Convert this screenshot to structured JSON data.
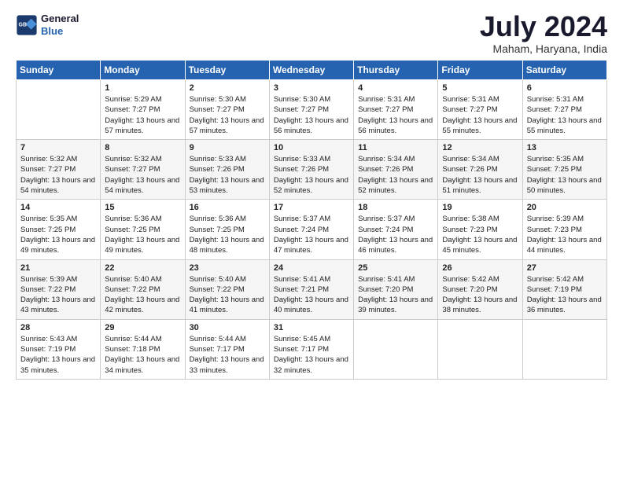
{
  "logo": {
    "line1": "General",
    "line2": "Blue"
  },
  "title": "July 2024",
  "location": "Maham, Haryana, India",
  "headers": [
    "Sunday",
    "Monday",
    "Tuesday",
    "Wednesday",
    "Thursday",
    "Friday",
    "Saturday"
  ],
  "weeks": [
    [
      {
        "day": "",
        "sunrise": "",
        "sunset": "",
        "daylight": ""
      },
      {
        "day": "1",
        "sunrise": "Sunrise: 5:29 AM",
        "sunset": "Sunset: 7:27 PM",
        "daylight": "Daylight: 13 hours and 57 minutes."
      },
      {
        "day": "2",
        "sunrise": "Sunrise: 5:30 AM",
        "sunset": "Sunset: 7:27 PM",
        "daylight": "Daylight: 13 hours and 57 minutes."
      },
      {
        "day": "3",
        "sunrise": "Sunrise: 5:30 AM",
        "sunset": "Sunset: 7:27 PM",
        "daylight": "Daylight: 13 hours and 56 minutes."
      },
      {
        "day": "4",
        "sunrise": "Sunrise: 5:31 AM",
        "sunset": "Sunset: 7:27 PM",
        "daylight": "Daylight: 13 hours and 56 minutes."
      },
      {
        "day": "5",
        "sunrise": "Sunrise: 5:31 AM",
        "sunset": "Sunset: 7:27 PM",
        "daylight": "Daylight: 13 hours and 55 minutes."
      },
      {
        "day": "6",
        "sunrise": "Sunrise: 5:31 AM",
        "sunset": "Sunset: 7:27 PM",
        "daylight": "Daylight: 13 hours and 55 minutes."
      }
    ],
    [
      {
        "day": "7",
        "sunrise": "Sunrise: 5:32 AM",
        "sunset": "Sunset: 7:27 PM",
        "daylight": "Daylight: 13 hours and 54 minutes."
      },
      {
        "day": "8",
        "sunrise": "Sunrise: 5:32 AM",
        "sunset": "Sunset: 7:27 PM",
        "daylight": "Daylight: 13 hours and 54 minutes."
      },
      {
        "day": "9",
        "sunrise": "Sunrise: 5:33 AM",
        "sunset": "Sunset: 7:26 PM",
        "daylight": "Daylight: 13 hours and 53 minutes."
      },
      {
        "day": "10",
        "sunrise": "Sunrise: 5:33 AM",
        "sunset": "Sunset: 7:26 PM",
        "daylight": "Daylight: 13 hours and 52 minutes."
      },
      {
        "day": "11",
        "sunrise": "Sunrise: 5:34 AM",
        "sunset": "Sunset: 7:26 PM",
        "daylight": "Daylight: 13 hours and 52 minutes."
      },
      {
        "day": "12",
        "sunrise": "Sunrise: 5:34 AM",
        "sunset": "Sunset: 7:26 PM",
        "daylight": "Daylight: 13 hours and 51 minutes."
      },
      {
        "day": "13",
        "sunrise": "Sunrise: 5:35 AM",
        "sunset": "Sunset: 7:25 PM",
        "daylight": "Daylight: 13 hours and 50 minutes."
      }
    ],
    [
      {
        "day": "14",
        "sunrise": "Sunrise: 5:35 AM",
        "sunset": "Sunset: 7:25 PM",
        "daylight": "Daylight: 13 hours and 49 minutes."
      },
      {
        "day": "15",
        "sunrise": "Sunrise: 5:36 AM",
        "sunset": "Sunset: 7:25 PM",
        "daylight": "Daylight: 13 hours and 49 minutes."
      },
      {
        "day": "16",
        "sunrise": "Sunrise: 5:36 AM",
        "sunset": "Sunset: 7:25 PM",
        "daylight": "Daylight: 13 hours and 48 minutes."
      },
      {
        "day": "17",
        "sunrise": "Sunrise: 5:37 AM",
        "sunset": "Sunset: 7:24 PM",
        "daylight": "Daylight: 13 hours and 47 minutes."
      },
      {
        "day": "18",
        "sunrise": "Sunrise: 5:37 AM",
        "sunset": "Sunset: 7:24 PM",
        "daylight": "Daylight: 13 hours and 46 minutes."
      },
      {
        "day": "19",
        "sunrise": "Sunrise: 5:38 AM",
        "sunset": "Sunset: 7:23 PM",
        "daylight": "Daylight: 13 hours and 45 minutes."
      },
      {
        "day": "20",
        "sunrise": "Sunrise: 5:39 AM",
        "sunset": "Sunset: 7:23 PM",
        "daylight": "Daylight: 13 hours and 44 minutes."
      }
    ],
    [
      {
        "day": "21",
        "sunrise": "Sunrise: 5:39 AM",
        "sunset": "Sunset: 7:22 PM",
        "daylight": "Daylight: 13 hours and 43 minutes."
      },
      {
        "day": "22",
        "sunrise": "Sunrise: 5:40 AM",
        "sunset": "Sunset: 7:22 PM",
        "daylight": "Daylight: 13 hours and 42 minutes."
      },
      {
        "day": "23",
        "sunrise": "Sunrise: 5:40 AM",
        "sunset": "Sunset: 7:22 PM",
        "daylight": "Daylight: 13 hours and 41 minutes."
      },
      {
        "day": "24",
        "sunrise": "Sunrise: 5:41 AM",
        "sunset": "Sunset: 7:21 PM",
        "daylight": "Daylight: 13 hours and 40 minutes."
      },
      {
        "day": "25",
        "sunrise": "Sunrise: 5:41 AM",
        "sunset": "Sunset: 7:20 PM",
        "daylight": "Daylight: 13 hours and 39 minutes."
      },
      {
        "day": "26",
        "sunrise": "Sunrise: 5:42 AM",
        "sunset": "Sunset: 7:20 PM",
        "daylight": "Daylight: 13 hours and 38 minutes."
      },
      {
        "day": "27",
        "sunrise": "Sunrise: 5:42 AM",
        "sunset": "Sunset: 7:19 PM",
        "daylight": "Daylight: 13 hours and 36 minutes."
      }
    ],
    [
      {
        "day": "28",
        "sunrise": "Sunrise: 5:43 AM",
        "sunset": "Sunset: 7:19 PM",
        "daylight": "Daylight: 13 hours and 35 minutes."
      },
      {
        "day": "29",
        "sunrise": "Sunrise: 5:44 AM",
        "sunset": "Sunset: 7:18 PM",
        "daylight": "Daylight: 13 hours and 34 minutes."
      },
      {
        "day": "30",
        "sunrise": "Sunrise: 5:44 AM",
        "sunset": "Sunset: 7:17 PM",
        "daylight": "Daylight: 13 hours and 33 minutes."
      },
      {
        "day": "31",
        "sunrise": "Sunrise: 5:45 AM",
        "sunset": "Sunset: 7:17 PM",
        "daylight": "Daylight: 13 hours and 32 minutes."
      },
      {
        "day": "",
        "sunrise": "",
        "sunset": "",
        "daylight": ""
      },
      {
        "day": "",
        "sunrise": "",
        "sunset": "",
        "daylight": ""
      },
      {
        "day": "",
        "sunrise": "",
        "sunset": "",
        "daylight": ""
      }
    ]
  ]
}
